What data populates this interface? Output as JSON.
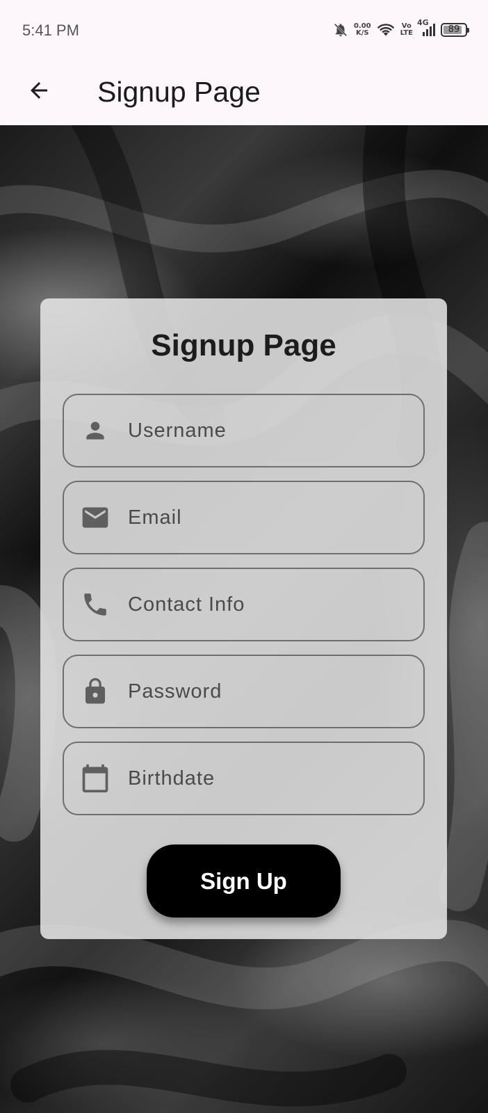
{
  "status_bar": {
    "time": "5:41 PM",
    "net_speed_value": "0.00",
    "net_speed_unit": "K/S",
    "volte_top": "Vo",
    "volte_bottom": "LTE",
    "network": "4G",
    "battery": "89",
    "battery_level": 0.89,
    "icons": [
      "bell-off-icon",
      "wifi-icon",
      "signal-icon",
      "battery-icon"
    ]
  },
  "app_bar": {
    "title": "Signup Page",
    "back_icon": "arrow-back-icon"
  },
  "card": {
    "title": "Signup Page",
    "fields": [
      {
        "placeholder": "Username",
        "icon": "person-icon"
      },
      {
        "placeholder": "Email",
        "icon": "mail-icon"
      },
      {
        "placeholder": "Contact Info",
        "icon": "phone-icon"
      },
      {
        "placeholder": "Password",
        "icon": "lock-icon"
      },
      {
        "placeholder": "Birthdate",
        "icon": "calendar-icon"
      }
    ],
    "submit_label": "Sign Up"
  },
  "colors": {
    "app_bar_bg": "#fdf7fc",
    "icon_gray": "#5f5f5f",
    "button_bg": "#000000",
    "button_text": "#ffffff"
  }
}
